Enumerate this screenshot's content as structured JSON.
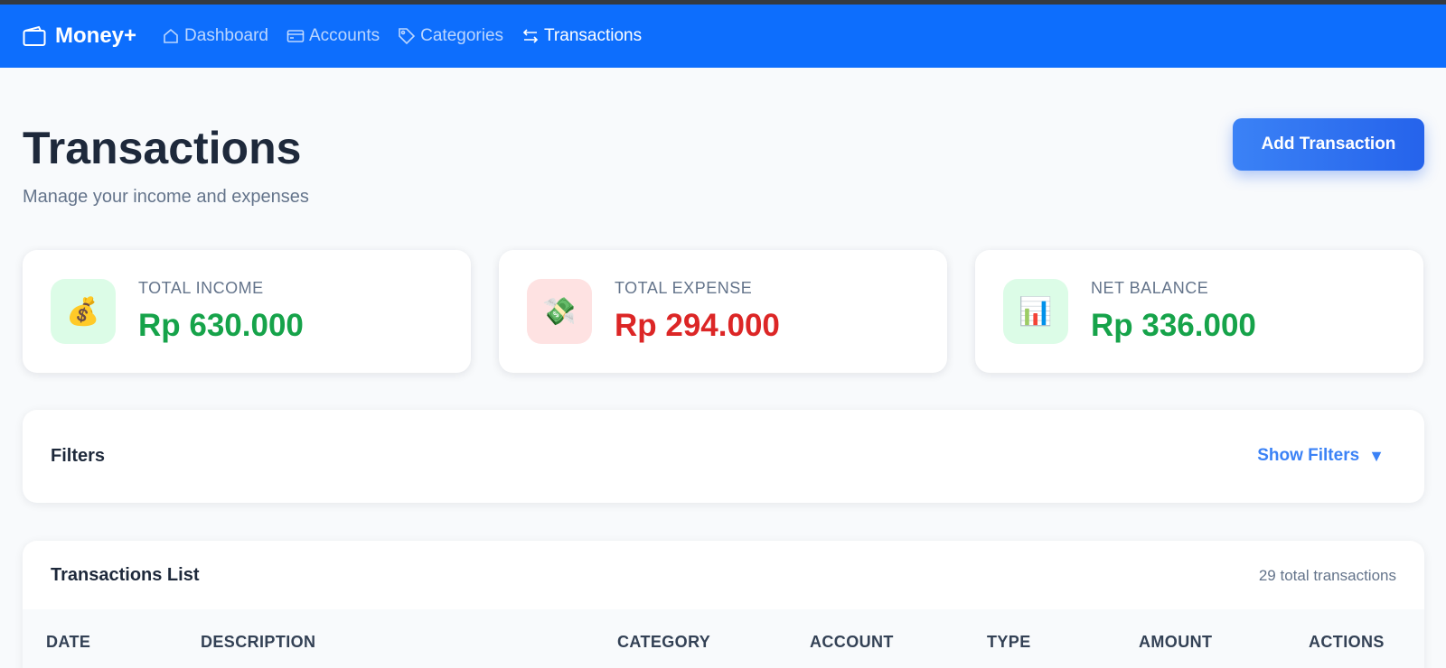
{
  "nav": {
    "brand": "Money+",
    "items": [
      {
        "label": "Dashboard"
      },
      {
        "label": "Accounts"
      },
      {
        "label": "Categories"
      },
      {
        "label": "Transactions"
      }
    ]
  },
  "page": {
    "title": "Transactions",
    "subtitle": "Manage your income and expenses",
    "add_button": "Add Transaction"
  },
  "summary": [
    {
      "label": "TOTAL INCOME",
      "value": "Rp 630.000",
      "icon": "money-bag",
      "emoji": "💰",
      "color": "#16a34a",
      "bg": "#dcfce7"
    },
    {
      "label": "TOTAL EXPENSE",
      "value": "Rp 294.000",
      "icon": "money-with-wings",
      "emoji": "💸",
      "color": "#dc2626",
      "bg": "#fee2e2"
    },
    {
      "label": "NET BALANCE",
      "value": "Rp 336.000",
      "icon": "bar-chart",
      "emoji": "📊",
      "color": "#16a34a",
      "bg": "#dcfce7"
    }
  ],
  "filters": {
    "title": "Filters",
    "toggle": "Show Filters",
    "caret": "▼"
  },
  "list": {
    "title": "Transactions List",
    "count": "29 total transactions",
    "columns": [
      "DATE",
      "DESCRIPTION",
      "CATEGORY",
      "ACCOUNT",
      "TYPE",
      "AMOUNT",
      "ACTIONS"
    ]
  },
  "colors": {
    "navbar": "#0d6efd",
    "accent": "#3b82f6",
    "income": "#16a34a",
    "expense": "#dc2626"
  }
}
